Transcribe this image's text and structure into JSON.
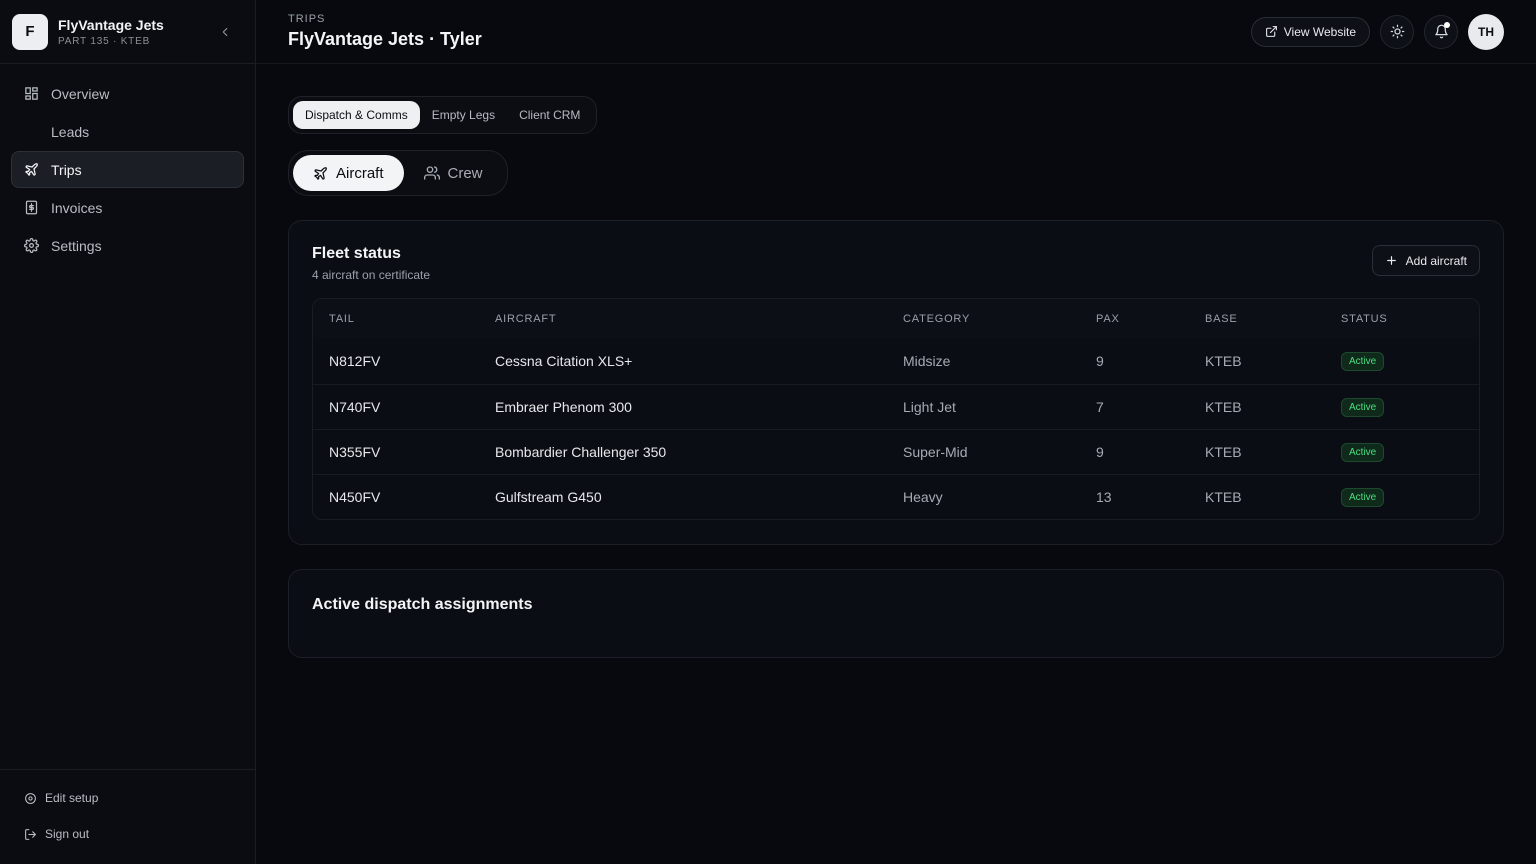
{
  "brand": {
    "logo_letter": "F",
    "name": "FlyVantage Jets",
    "sub": "PART 135 · KTEB"
  },
  "sidebar": {
    "items": [
      {
        "label": "Overview",
        "icon": "grid-icon",
        "active": false
      },
      {
        "label": "Leads",
        "icon": "inbox-icon",
        "active": false
      },
      {
        "label": "Trips",
        "icon": "plane-icon",
        "active": true
      },
      {
        "label": "Invoices",
        "icon": "receipt-icon",
        "active": false
      },
      {
        "label": "Settings",
        "icon": "gear-icon",
        "active": false
      }
    ],
    "footer": {
      "edit_setup": "Edit setup",
      "sign_out": "Sign out"
    }
  },
  "header": {
    "crumb": "TRIPS",
    "title": "FlyVantage Jets · Tyler",
    "view_website": "View Website",
    "avatar": "TH"
  },
  "tabs": [
    {
      "label": "Dispatch & Comms",
      "active": true
    },
    {
      "label": "Empty Legs",
      "active": false
    },
    {
      "label": "Client CRM",
      "active": false
    }
  ],
  "segment": {
    "aircraft": "Aircraft",
    "crew": "Crew",
    "active": "aircraft"
  },
  "fleet": {
    "title": "Fleet status",
    "subtitle": "4 aircraft on certificate",
    "add_label": "Add aircraft",
    "columns": [
      "TAIL",
      "AIRCRAFT",
      "CATEGORY",
      "PAX",
      "BASE",
      "STATUS"
    ],
    "rows": [
      {
        "tail": "N812FV",
        "aircraft": "Cessna Citation XLS+",
        "category": "Midsize",
        "pax": "9",
        "base": "KTEB",
        "status": "Active"
      },
      {
        "tail": "N740FV",
        "aircraft": "Embraer Phenom 300",
        "category": "Light Jet",
        "pax": "7",
        "base": "KTEB",
        "status": "Active"
      },
      {
        "tail": "N355FV",
        "aircraft": "Bombardier Challenger 350",
        "category": "Super-Mid",
        "pax": "9",
        "base": "KTEB",
        "status": "Active"
      },
      {
        "tail": "N450FV",
        "aircraft": "Gulfstream G450",
        "category": "Heavy",
        "pax": "13",
        "base": "KTEB",
        "status": "Active"
      }
    ]
  },
  "dispatch": {
    "title": "Active dispatch assignments"
  },
  "colors": {
    "status_active": "#4ade80",
    "background": "#07090e"
  }
}
